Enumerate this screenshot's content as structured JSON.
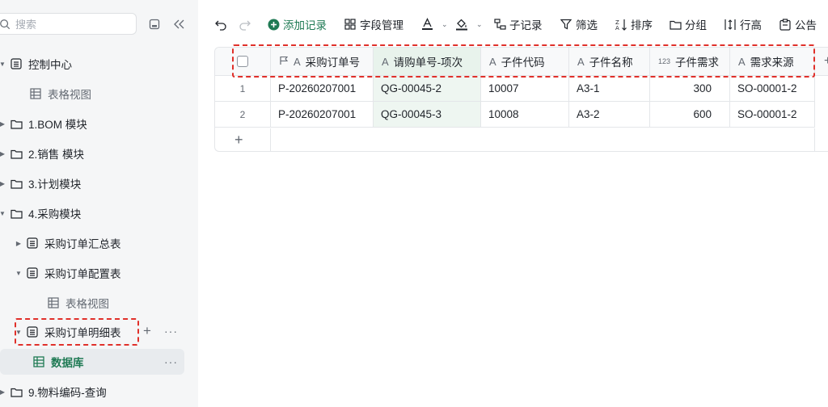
{
  "sidebar": {
    "search_placeholder": "搜索",
    "tree": [
      {
        "label": "控制中心"
      },
      {
        "label": "表格视图"
      },
      {
        "label": "1.BOM 模块"
      },
      {
        "label": "2.销售 模块"
      },
      {
        "label": "3.计划模块"
      },
      {
        "label": "4.采购模块"
      },
      {
        "label": "采购订单汇总表"
      },
      {
        "label": "采购订单配置表"
      },
      {
        "label": "表格视图"
      },
      {
        "label": "采购订单明细表"
      },
      {
        "label": "数据库"
      },
      {
        "label": "9.物料编码-查询"
      }
    ]
  },
  "toolbar": {
    "add_record": "添加记录",
    "field_manage": "字段管理",
    "sub_record": "子记录",
    "filter": "筛选",
    "sort": "排序",
    "group": "分组",
    "row_height": "行高",
    "notice": "公告"
  },
  "table": {
    "columns": [
      "采购订单号",
      "请购单号-项次",
      "子件代码",
      "子件名称",
      "子件需求",
      "需求来源"
    ],
    "rows": [
      {
        "num": "1",
        "cells": [
          "P-20260207001",
          "QG-00045-2",
          "10007",
          "A3-1",
          "300",
          "SO-00001-2"
        ]
      },
      {
        "num": "2",
        "cells": [
          "P-20260207001",
          "QG-00045-3",
          "10008",
          "A3-2",
          "600",
          "SO-00001-2"
        ]
      }
    ],
    "num_type_label": "123"
  },
  "colors": {
    "accent": "#1f7a54",
    "highlight_col": "#eef6f1",
    "dashed_annotation": "#e0302a"
  }
}
